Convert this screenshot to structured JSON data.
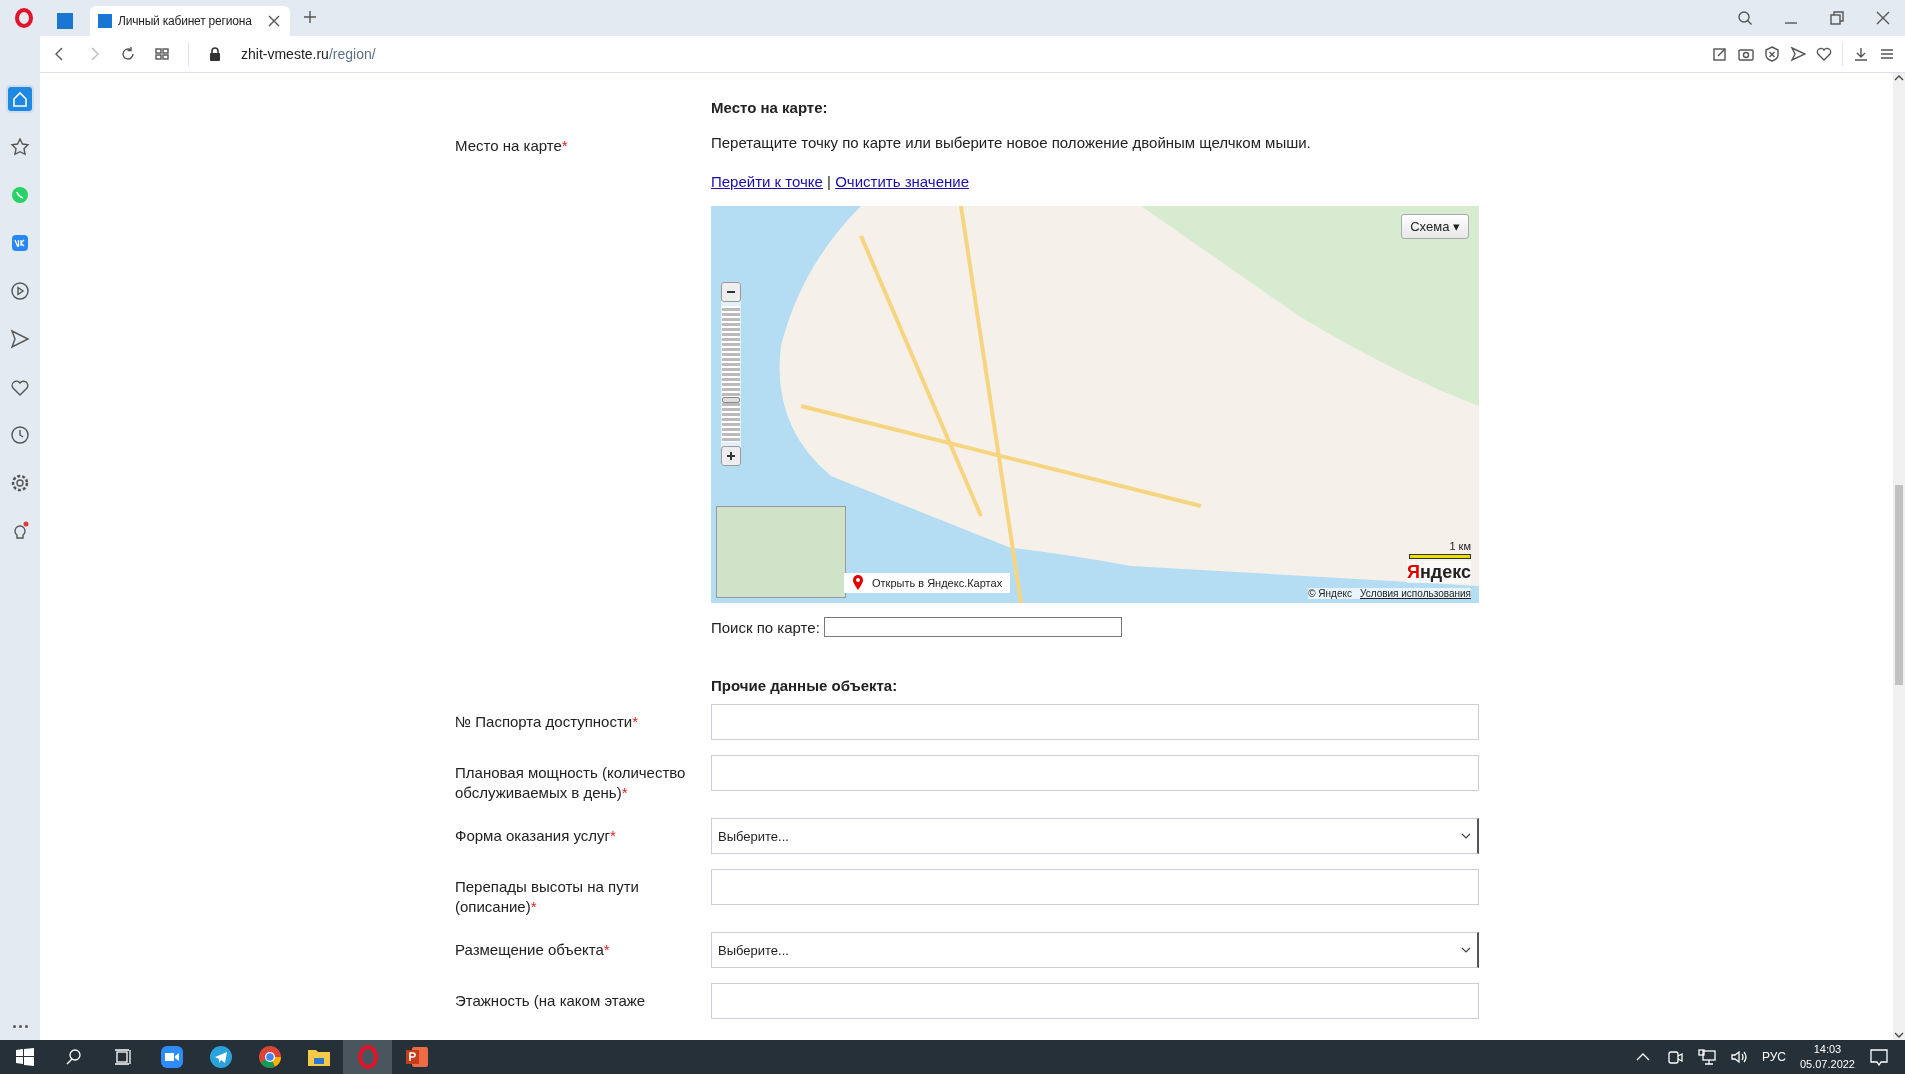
{
  "required_mark": "*",
  "browser": {
    "tabs": [
      {
        "title": "Личный кабинет региона",
        "selected": true
      }
    ],
    "address": {
      "domain": "zhit-vmeste.ru",
      "path": "/region/"
    }
  },
  "sidebar": {
    "items": [
      {
        "kind": "home",
        "selected": true
      },
      {
        "kind": "star",
        "selected": false
      },
      {
        "kind": "whatsapp",
        "selected": false
      },
      {
        "kind": "vk",
        "selected": false
      },
      {
        "kind": "play",
        "selected": false
      },
      {
        "kind": "send",
        "selected": false
      },
      {
        "kind": "heart",
        "selected": false
      },
      {
        "kind": "history",
        "selected": false
      },
      {
        "kind": "settings",
        "selected": false
      },
      {
        "kind": "bulb",
        "selected": false
      },
      {
        "kind": "more",
        "selected": false
      }
    ]
  },
  "map_section": {
    "heading": "Место на карте:",
    "label": "Место на карте",
    "required": true,
    "instruction": "Перетащите точку по карте или выберите новое положение двойным щелчком мыши.",
    "links": [
      "Перейти к точке",
      "Очистить значение"
    ],
    "separator": "|",
    "map": {
      "layer_button": "Схема ▾",
      "level": 0.3,
      "open_link": "Открыть в Яндекс.Картах",
      "scale": "1 км",
      "logo": "Яндекс",
      "copyright": "© Яндекс",
      "terms": "Условия использования"
    },
    "search": {
      "label": "Поиск по карте:"
    }
  },
  "other_section": {
    "heading": "Прочие данные объекта:",
    "fields": [
      {
        "label": "№ Паспорта доступности",
        "required": true,
        "kind": "text"
      },
      {
        "label": "Плановая мощность (количество обслуживаемых в день)",
        "required": true,
        "kind": "text"
      },
      {
        "label": "Форма оказания услуг",
        "required": true,
        "kind": "select",
        "value": "Выберите..."
      },
      {
        "label": "Перепады высоты на пути (описание)",
        "required": true,
        "kind": "text"
      },
      {
        "label": "Размещение объекта",
        "required": true,
        "kind": "select",
        "value": "Выберите..."
      },
      {
        "label": "Этажность (на каком этаже",
        "required": false,
        "kind": "text"
      }
    ]
  },
  "taskbar": {
    "apps": [
      {
        "kind": "zoom",
        "selected": false
      },
      {
        "kind": "telegram",
        "selected": false
      },
      {
        "kind": "chrome",
        "selected": false
      },
      {
        "kind": "explorer",
        "selected": false
      },
      {
        "kind": "opera",
        "selected": true
      },
      {
        "kind": "powerpoint",
        "selected": false
      }
    ],
    "language": "РУС",
    "time": "14:03",
    "date": "05.07.2022"
  }
}
